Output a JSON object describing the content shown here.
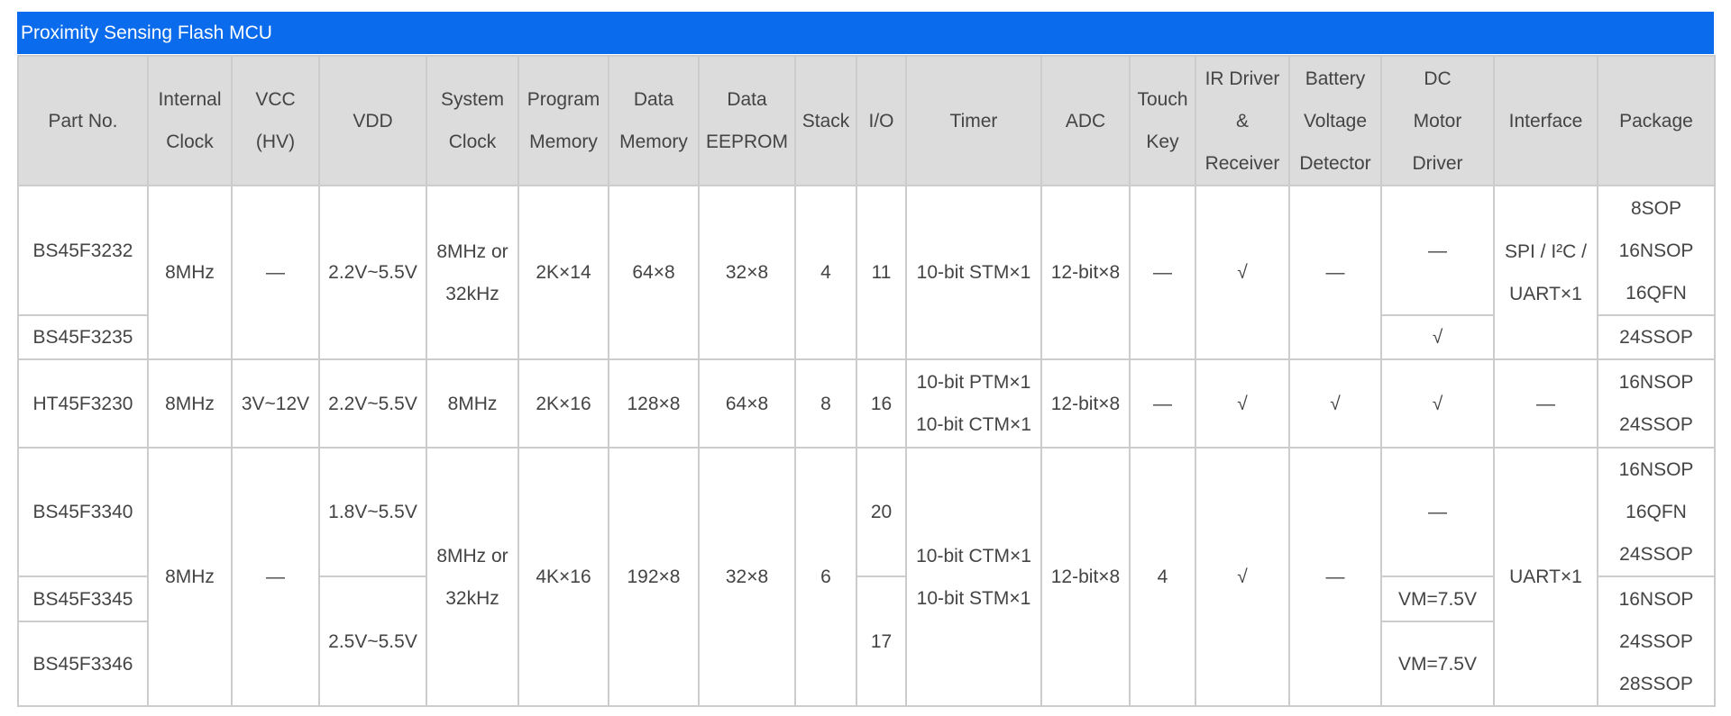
{
  "title": "Proximity Sensing Flash MCU",
  "headers": [
    [
      "Part No."
    ],
    [
      "Internal",
      "Clock"
    ],
    [
      "VCC",
      "(HV)"
    ],
    [
      "VDD"
    ],
    [
      "System",
      "Clock"
    ],
    [
      "Program",
      "Memory"
    ],
    [
      "Data",
      "Memory"
    ],
    [
      "Data",
      "EEPROM"
    ],
    [
      "Stack"
    ],
    [
      "I/O"
    ],
    [
      "Timer"
    ],
    [
      "ADC"
    ],
    [
      "Touch",
      "Key"
    ],
    [
      "IR Driver",
      "&",
      "Receiver"
    ],
    [
      "Battery",
      "Voltage",
      "Detector"
    ],
    [
      "DC",
      "Motor",
      "Driver"
    ],
    [
      "Interface"
    ],
    [
      "Package"
    ]
  ],
  "group1": {
    "part_a": "BS45F3232",
    "part_b": "BS45F3235",
    "internal_clock": "8MHz",
    "vcc": "—",
    "vdd": "2.2V~5.5V",
    "system_clock": [
      "8MHz or",
      "32kHz"
    ],
    "program_memory": "2K×14",
    "data_memory": "64×8",
    "data_eeprom": "32×8",
    "stack": "4",
    "io": "11",
    "timer": "10-bit STM×1",
    "adc": "12-bit×8",
    "touch_key": "—",
    "ir_driver": "√",
    "battery_detector": "—",
    "motor_a": "—",
    "motor_b": "√",
    "interface": [
      "SPI / I²C /",
      "UART×1"
    ],
    "package_a": [
      "8SOP",
      "16NSOP",
      "16QFN"
    ],
    "package_b": "24SSOP"
  },
  "group2": {
    "part": "HT45F3230",
    "internal_clock": "8MHz",
    "vcc": "3V~12V",
    "vdd": "2.2V~5.5V",
    "system_clock": "8MHz",
    "program_memory": "2K×16",
    "data_memory": "128×8",
    "data_eeprom": "64×8",
    "stack": "8",
    "io": "16",
    "timer": [
      "10-bit PTM×1",
      "10-bit CTM×1"
    ],
    "adc": "12-bit×8",
    "touch_key": "—",
    "ir_driver": "√",
    "battery_detector": "√",
    "motor": "√",
    "interface": "—",
    "package": [
      "16NSOP",
      "24SSOP"
    ]
  },
  "group3": {
    "part_a": "BS45F3340",
    "part_b": "BS45F3345",
    "part_c": "BS45F3346",
    "internal_clock": "8MHz",
    "vcc": "—",
    "vdd_a": "1.8V~5.5V",
    "vdd_b": "2.5V~5.5V",
    "system_clock": [
      "8MHz or",
      "32kHz"
    ],
    "program_memory": "4K×16",
    "data_memory": "192×8",
    "data_eeprom": "32×8",
    "stack": "6",
    "io_a": "20",
    "io_b": "17",
    "timer": [
      "10-bit CTM×1",
      "10-bit STM×1"
    ],
    "adc": "12-bit×8",
    "touch_key": "4",
    "ir_driver": "√",
    "battery_detector": "—",
    "motor_a": "—",
    "motor_b": "VM=7.5V",
    "motor_c": "VM=7.5V",
    "interface": "UART×1",
    "package_a": [
      "16NSOP",
      "16QFN",
      "24SSOP"
    ],
    "package_b": [
      "16NSOP",
      "24SSOP",
      "28SSOP"
    ]
  }
}
